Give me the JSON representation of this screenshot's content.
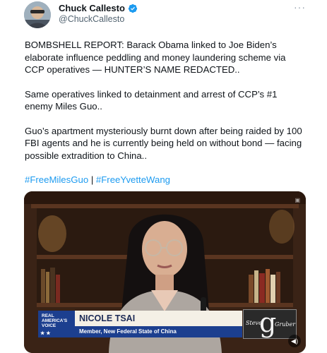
{
  "author": {
    "name": "Chuck Callesto",
    "handle": "@ChuckCallesto",
    "verified": true,
    "avatar_icon": "profile-photo",
    "more_icon": "more-icon"
  },
  "tweet": {
    "paragraphs": [
      "BOMBSHELL REPORT: Barack Obama linked to Joe Biden’s elaborate influence peddling and money laundering scheme via CCP operatives — HUNTER’S NAME REDACTED..",
      "Same operatives linked to detainment and arrest of CCP’s #1  enemy Miles Guo..",
      "Guo’s apartment mysteriously burnt down after being raided by 100 FBI agents and he is currently being held on without bond — facing possible extradition to China.."
    ],
    "hashtags": [
      "#FreeMilesGuo",
      "#FreeYvetteWang"
    ],
    "hashtag_separator": " | "
  },
  "media": {
    "lower_third": {
      "network_line1": "REAL",
      "network_line2": "AMERICA'S",
      "network_line3": "VOICE",
      "stars": "★         ★",
      "guest_name": "NICOLE TSAI",
      "guest_title": "Member, New Federal State of China"
    },
    "show_logo": {
      "big_letter": "g",
      "left_word": "Steve",
      "right_word": "Gruber"
    },
    "volume_icon": "volume-icon",
    "colors": {
      "banner_blue": "#1c3f8f",
      "banner_cream": "#f4f0e6",
      "hashtag_blue": "#1d9bf0"
    }
  }
}
